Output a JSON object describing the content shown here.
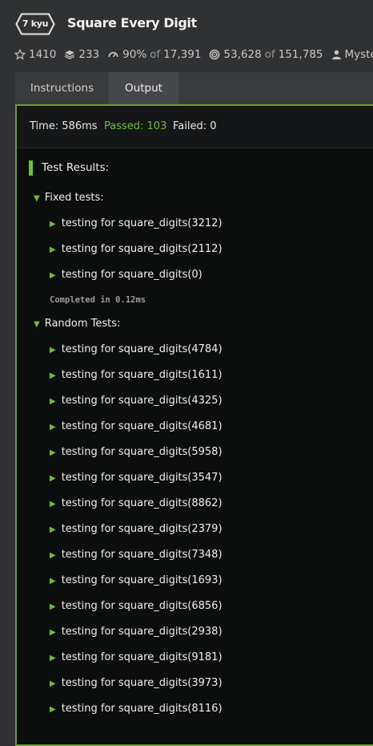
{
  "header": {
    "rank_badge": "7 kyu",
    "title": "Square Every Digit",
    "stats": {
      "stars": "1410",
      "collections": "233",
      "satisfaction_percent": "90%",
      "satisfaction_of_label": "of",
      "satisfaction_total": "17,391",
      "completions": "53,628",
      "completions_of_label": "of",
      "completions_total": "151,785",
      "author": "Myster"
    }
  },
  "tabs": [
    {
      "label": "Instructions",
      "active": false
    },
    {
      "label": "Output",
      "active": true
    }
  ],
  "output": {
    "summary": {
      "time": "Time: 586ms",
      "passed": "Passed: 103",
      "failed": "Failed: 0"
    },
    "results_title": "Test Results:",
    "groups": [
      {
        "label": "Fixed tests:",
        "tests": [
          "testing for square_digits(3212)",
          "testing for square_digits(2112)",
          "testing for square_digits(0)"
        ],
        "completed": "Completed in 0.12ms"
      },
      {
        "label": "Random Tests:",
        "tests": [
          "testing for square_digits(4784)",
          "testing for square_digits(1611)",
          "testing for square_digits(4325)",
          "testing for square_digits(4681)",
          "testing for square_digits(5958)",
          "testing for square_digits(3547)",
          "testing for square_digits(8862)",
          "testing for square_digits(2379)",
          "testing for square_digits(7348)",
          "testing for square_digits(1693)",
          "testing for square_digits(6856)",
          "testing for square_digits(2938)",
          "testing for square_digits(9181)",
          "testing for square_digits(3973)",
          "testing for square_digits(8116)"
        ]
      }
    ]
  },
  "colors": {
    "accent_green": "#6cbf3c",
    "panel_border": "#6f9b38",
    "background": "#303133"
  }
}
